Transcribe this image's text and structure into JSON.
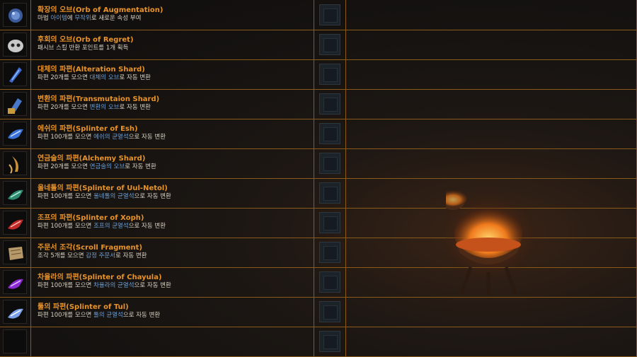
{
  "items": [
    {
      "icon": "orb-of-augmentation-icon",
      "name": "확장의 오브(Orb of Augmentation)",
      "desc": [
        [
          "마법 ",
          0
        ],
        [
          "아이템",
          1
        ],
        [
          "에 ",
          0
        ],
        [
          "무작위",
          1
        ],
        [
          "로 새로운 속성 부여",
          0
        ]
      ]
    },
    {
      "icon": "orb-of-regret-icon",
      "name": "후회의 오브(Orb of Regret)",
      "desc": [
        [
          "패시브 스킬 반환 포인트를 1개 획득",
          0
        ]
      ]
    },
    {
      "icon": "alteration-shard-icon",
      "name": "대체의 파편(Alteration Shard)",
      "desc": [
        [
          "파편 20개를 모으면 ",
          0
        ],
        [
          "대체의 오브",
          1
        ],
        [
          "로 자동 변환",
          0
        ]
      ]
    },
    {
      "icon": "transmutation-shard-icon",
      "name": "변환의 파편(Transmutaion Shard)",
      "desc": [
        [
          "파편 20개를 모으면 ",
          0
        ],
        [
          "변환의 오브",
          1
        ],
        [
          "로 자동 변환",
          0
        ]
      ]
    },
    {
      "icon": "splinter-of-esh-icon",
      "name": "에쉬의 파편(Splinter of Esh)",
      "desc": [
        [
          "파편 100개를 모으면 ",
          0
        ],
        [
          "에쉬의 균열석",
          1
        ],
        [
          "으로 자동 변환",
          0
        ]
      ]
    },
    {
      "icon": "alchemy-shard-icon",
      "name": "연금술의 파편(Alchemy Shard)",
      "desc": [
        [
          "파편 20개를 모으면 ",
          0
        ],
        [
          "연금술의 오브",
          1
        ],
        [
          "로 자동 변환",
          0
        ]
      ]
    },
    {
      "icon": "splinter-of-uul-netol-icon",
      "name": "울네톨의 파편(Splinter of Uul-Netol)",
      "desc": [
        [
          "파편 100개를 모으면 ",
          0
        ],
        [
          "울네톨의 균열석",
          1
        ],
        [
          "으로 자동 변환",
          0
        ]
      ]
    },
    {
      "icon": "splinter-of-xoph-icon",
      "name": "조프의 파편(Splinter of Xoph)",
      "desc": [
        [
          "파편 100개를 모으면 ",
          0
        ],
        [
          "조프의 균열석",
          1
        ],
        [
          "으로 자동 변환",
          0
        ]
      ]
    },
    {
      "icon": "scroll-fragment-icon",
      "name": "주문서 조각(Scroll Fragment)",
      "desc": [
        [
          "조각 5개를 모으면 ",
          0
        ],
        [
          "감정 주문서",
          1
        ],
        [
          "로 자동 변환",
          0
        ]
      ]
    },
    {
      "icon": "splinter-of-chayula-icon",
      "name": "차율라의 파편(Splinter of Chayula)",
      "desc": [
        [
          "파편 100개를 모으면 ",
          0
        ],
        [
          "차율라의 균열석",
          1
        ],
        [
          "으로 자동 변환",
          0
        ]
      ]
    },
    {
      "icon": "splinter-of-tul-icon",
      "name": "툴의 파편(Splinter of Tul)",
      "desc": [
        [
          "파편 100개를 모으면 ",
          0
        ],
        [
          "툴의 균열석",
          1
        ],
        [
          "으로 자동 변환",
          0
        ]
      ]
    },
    {
      "icon": "empty-slot-icon",
      "name": "",
      "desc": []
    }
  ],
  "colors": {
    "border": "#8a5a1a",
    "name": "#e8932a",
    "text": "#d8cfc2",
    "highlight": "#6e9fd6"
  }
}
